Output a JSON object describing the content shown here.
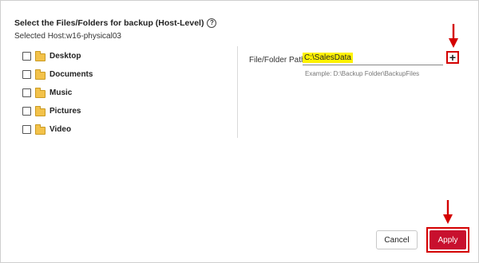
{
  "dialog": {
    "title": "Select the Files/Folders for backup (Host-Level)",
    "help_glyph": "?",
    "selected_host": "Selected Host:w16-physical03"
  },
  "folders": [
    {
      "label": "Desktop",
      "checked": false
    },
    {
      "label": "Documents",
      "checked": false
    },
    {
      "label": "Music",
      "checked": false
    },
    {
      "label": "Pictures",
      "checked": false
    },
    {
      "label": "Video",
      "checked": false
    }
  ],
  "path": {
    "label": "File/Folder Path",
    "value": "C:\\SalesData",
    "example": "Example: D:\\Backup Folder\\BackupFiles",
    "add_glyph": "+"
  },
  "footer": {
    "cancel_label": "Cancel",
    "apply_label": "Apply"
  },
  "colors": {
    "highlight": "#fff200",
    "accent_red": "#c8102e",
    "annotation_red": "#d40000"
  },
  "icons": {
    "help": "help-circle-icon",
    "folder": "folder-icon",
    "add": "plus-icon",
    "annotation": "arrow-down-icon"
  }
}
